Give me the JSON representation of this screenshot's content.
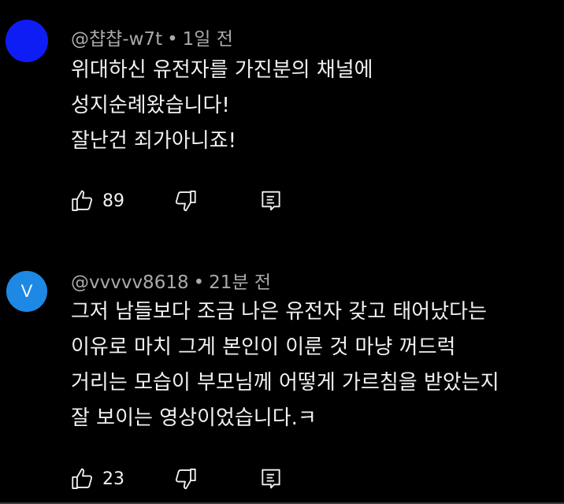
{
  "comments": [
    {
      "author": "@챱챱-w7t",
      "time": "1일 전",
      "avatar_letter": "",
      "avatar_color": "#0f1df5",
      "lines": [
        "위대하신 유전자를 가진분의 채널에",
        "성지순례왔습니다!",
        "잘난건 죄가아니죠!"
      ],
      "likes": "89"
    },
    {
      "author": "@vvvvv8618",
      "time": "21분 전",
      "avatar_letter": "V",
      "avatar_color": "#1e88e5",
      "lines": [
        "그저 남들보다 조금 나은 유전자 갖고 태어났다는",
        "이유로 마치 그게 본인이 이룬 것 마냥 꺼드럭",
        "거리는 모습이 부모님께 어떻게 가르침을 받았는지",
        "잘 보이는 영상이었습니다.ㅋ"
      ],
      "likes": "23"
    }
  ],
  "separator": "•",
  "icons": {
    "like": "thumbs-up-icon",
    "dislike": "thumbs-down-icon",
    "reply": "reply-comment-icon"
  },
  "colors": {
    "background": "#000000",
    "text": "#f1f1f1",
    "meta": "#aaaaaa"
  }
}
